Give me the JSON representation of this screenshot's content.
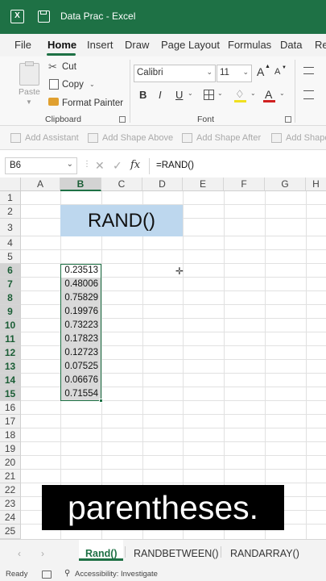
{
  "window": {
    "title": "Data Prac  -  Excel"
  },
  "menu": {
    "items": [
      "File",
      "Home",
      "Insert",
      "Draw",
      "Page Layout",
      "Formulas",
      "Data",
      "Re"
    ],
    "active": "Home"
  },
  "clipboard": {
    "paste": "Paste",
    "cut": "Cut",
    "copy": "Copy",
    "format_painter": "Format Painter",
    "label": "Clipboard"
  },
  "font": {
    "name": "Calibri",
    "size": "11",
    "bold": "B",
    "italic": "I",
    "underline": "U",
    "grow": "A",
    "shrink": "A",
    "color_letter": "A",
    "label": "Font"
  },
  "smartart": {
    "add_assistant": "Add Assistant",
    "add_shape_above": "Add Shape Above",
    "add_shape_after": "Add Shape After",
    "add_shape": "Add Shape"
  },
  "formula_bar": {
    "name_box": "B6",
    "fx": "fx",
    "formula": "=RAND()"
  },
  "grid": {
    "columns": [
      "A",
      "B",
      "C",
      "D",
      "E",
      "F",
      "G",
      "H"
    ],
    "rows": [
      "1",
      "2",
      "3",
      "4",
      "5",
      "6",
      "7",
      "8",
      "9",
      "10",
      "11",
      "12",
      "13",
      "14",
      "15",
      "16",
      "17",
      "18",
      "19",
      "20",
      "21",
      "22",
      "23",
      "24",
      "25"
    ],
    "header_cell": "RAND()",
    "b_values": [
      "0.23513",
      "0.48006",
      "0.75829",
      "0.19976",
      "0.73223",
      "0.17823",
      "0.12723",
      "0.07525",
      "0.06676",
      "0.71554"
    ]
  },
  "sheets": {
    "tabs": [
      "Rand()",
      "RANDBETWEEN()",
      "RANDARRAY()"
    ],
    "active": "Rand()"
  },
  "status": {
    "ready": "Ready",
    "accessibility": "Accessibility: Investigate"
  },
  "caption": {
    "text": "parentheses."
  },
  "colors": {
    "excel_green": "#1e7145",
    "header_fill": "#bdd7ee",
    "caption_bg": "#000000"
  }
}
